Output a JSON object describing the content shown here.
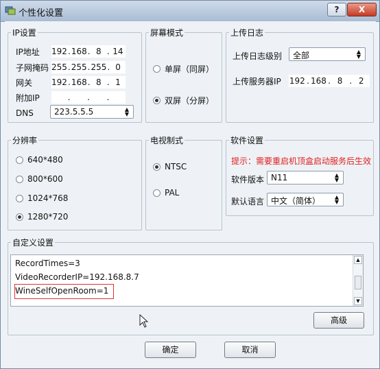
{
  "window": {
    "title": "个性化设置",
    "help_label": "?",
    "close_label": "X"
  },
  "ip_settings": {
    "legend": "IP设置",
    "ip_label": "IP地址",
    "ip": [
      "192",
      "168",
      "8",
      "14"
    ],
    "mask_label": "子网掩码",
    "mask": [
      "255",
      "255",
      "255",
      "0"
    ],
    "gateway_label": "网关",
    "gateway": [
      "192",
      "168",
      "8",
      "1"
    ],
    "extra_ip_label": "附加IP",
    "extra_ip": [
      "",
      "",
      "",
      ""
    ],
    "dns_label": "DNS",
    "dns_value": "223.5.5.5"
  },
  "screen_mode": {
    "legend": "屏幕模式",
    "options": [
      {
        "label": "单屏（同屏）",
        "selected": false
      },
      {
        "label": "双屏（分屏）",
        "selected": true
      }
    ]
  },
  "upload_log": {
    "legend": "上传日志",
    "level_label": "上传日志级别",
    "level_value": "全部",
    "server_label": "上传服务器IP",
    "server_ip": [
      "192",
      "168",
      "8",
      "2"
    ]
  },
  "resolution": {
    "legend": "分辨率",
    "options": [
      {
        "label": "640*480",
        "selected": false
      },
      {
        "label": "800*600",
        "selected": false
      },
      {
        "label": "1024*768",
        "selected": false
      },
      {
        "label": "1280*720",
        "selected": true
      }
    ]
  },
  "tv_system": {
    "legend": "电视制式",
    "options": [
      {
        "label": "NTSC",
        "selected": true
      },
      {
        "label": "PAL",
        "selected": false
      }
    ]
  },
  "software": {
    "legend": "软件设置",
    "note": "提示：需要重启机顶盒启动服务后生效",
    "version_label": "软件版本",
    "version_value": "N11",
    "language_label": "默认语言",
    "language_value": "中文（简体）"
  },
  "custom": {
    "legend": "自定义设置",
    "lines": [
      "RecordTimes=3",
      "VideoRecorderIP=192.168.8.7",
      "WineSelfOpenRoom=1"
    ],
    "advanced_label": "高级"
  },
  "footer": {
    "ok_label": "确定",
    "cancel_label": "取消"
  },
  "colors": {
    "note": "#e02020",
    "highlight_border": "#e03030",
    "close_button": "#c53b24"
  },
  "icons": {
    "app": "app-icon",
    "combo": "up-down-arrows-icon",
    "cursor": "mouse-pointer-icon"
  }
}
